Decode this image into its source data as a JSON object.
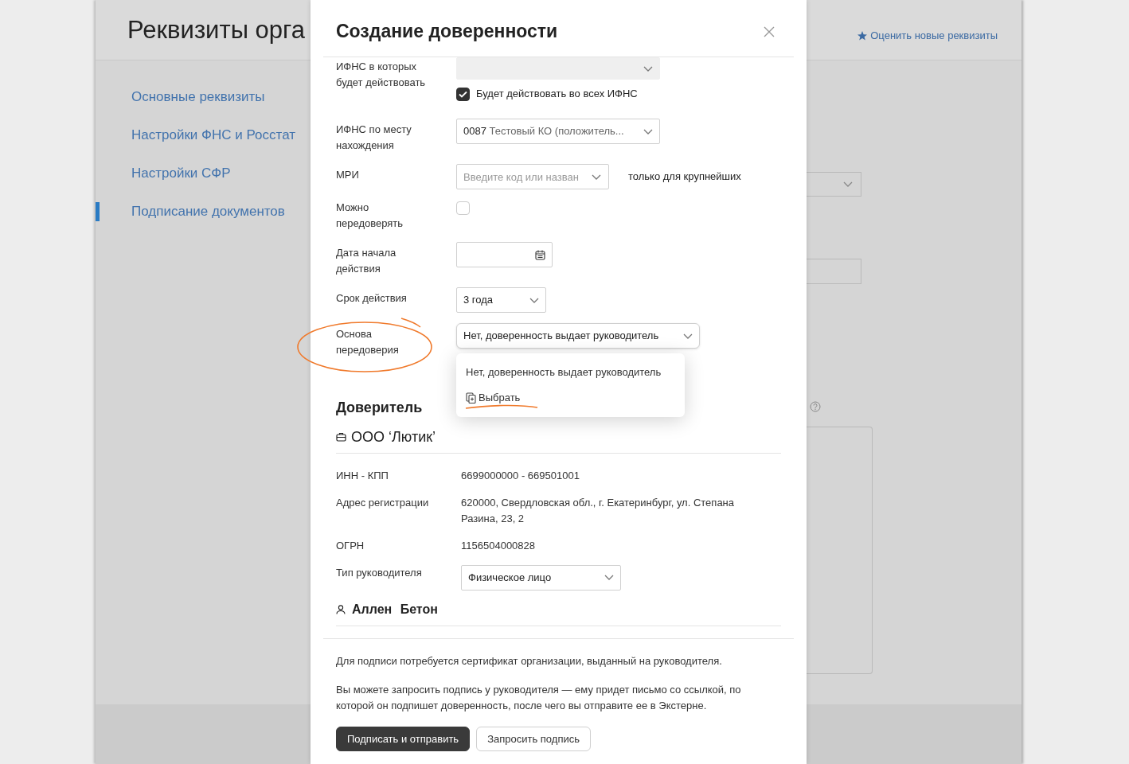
{
  "page": {
    "title": "Реквизиты орга",
    "rate_link": "Оценить новые реквизиты",
    "sidebar": [
      {
        "label": "Основные реквизиты",
        "selected": false
      },
      {
        "label": "Настройки ФНС и Росстат",
        "selected": false
      },
      {
        "label": "Настройки СФР",
        "selected": false
      },
      {
        "label": "Подписание документов",
        "selected": true
      }
    ]
  },
  "modal": {
    "title": "Создание доверенности",
    "fields": [
      {
        "kind": "select",
        "label": "ИФНС в которых будет действовать",
        "disabled": true,
        "expanded": false,
        "checkbox": {
          "label": "Будет действовать во всех ИФНС",
          "checked": true
        }
      },
      {
        "kind": "select",
        "label": "ИФНС по месту нахождения",
        "disabled": false,
        "expanded": false,
        "code": "0087",
        "value": "Тестовый КО (положитель..."
      },
      {
        "kind": "select",
        "label": "МРИ",
        "disabled": false,
        "expanded": false,
        "placeholder": "Введите код или назван",
        "note": "только для крупнейших"
      },
      {
        "kind": "checkbox",
        "label": "Можно передоверять",
        "checked": false
      },
      {
        "kind": "date",
        "label": "Дата начала действия"
      },
      {
        "kind": "select",
        "label": "Срок действия",
        "disabled": false,
        "expanded": false,
        "value": "3 года"
      },
      {
        "kind": "select",
        "label": "Основа передоверия",
        "disabled": false,
        "expanded": true,
        "value": "Нет, доверенность выдает руководитель",
        "options": [
          {
            "kind": "option",
            "label": "Нет, доверенность выдает руководитель"
          },
          {
            "kind": "action",
            "label": "Выбрать"
          }
        ]
      }
    ],
    "principal": {
      "title": "Доверитель",
      "org": "ООО ‘Лютик’",
      "rows": [
        {
          "kind": "text",
          "label": "ИНН - КПП",
          "value": "6699000000 - 669501001"
        },
        {
          "kind": "text",
          "label": "Адрес регистрации",
          "value": "620000, Свердловская обл., г. Екатеринбург, ул. Степана Разина, 23, 2"
        },
        {
          "kind": "text",
          "label": "ОГРН",
          "value": "1156504000828"
        },
        {
          "kind": "select",
          "label": "Тип руководителя",
          "value": "Физическое лицо"
        }
      ],
      "head": "Аллен Бетон"
    },
    "notes": [
      "Для подписи потребуется сертификат организации, выданный на руководителя.",
      "Вы можете запросить подпись у руководителя — ему придет письмо со ссылкой, по которой он подпишет доверенность, после чего вы отправите ее в Экстерне."
    ],
    "buttons": [
      {
        "kind": "primary",
        "label": "Подписать и отправить"
      },
      {
        "kind": "secondary",
        "label": "Запросить подпись"
      }
    ]
  }
}
